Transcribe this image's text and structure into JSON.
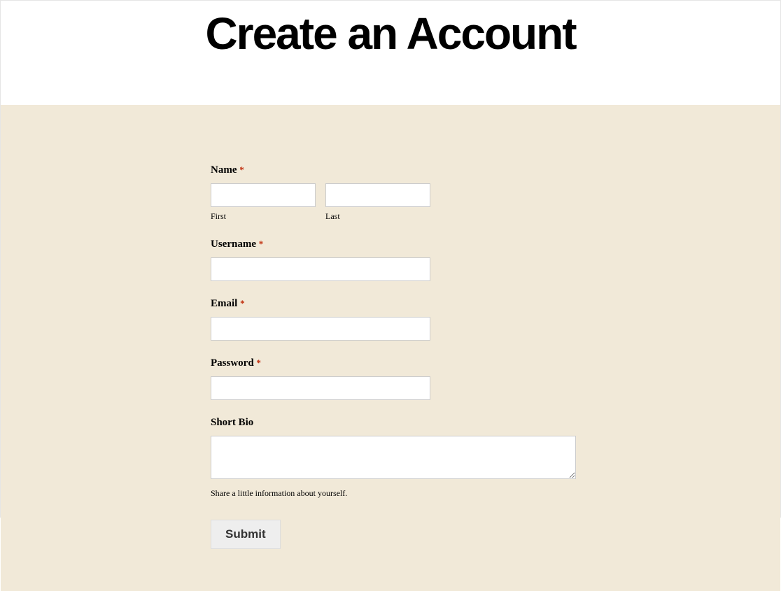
{
  "header": {
    "title": "Create an Account"
  },
  "form": {
    "name": {
      "label": "Name",
      "required_marker": "*",
      "first": {
        "sublabel": "First",
        "value": ""
      },
      "last": {
        "sublabel": "Last",
        "value": ""
      }
    },
    "username": {
      "label": "Username",
      "required_marker": "*",
      "value": ""
    },
    "email": {
      "label": "Email",
      "required_marker": "*",
      "value": ""
    },
    "password": {
      "label": "Password",
      "required_marker": "*",
      "value": ""
    },
    "bio": {
      "label": "Short Bio",
      "helper": "Share a little information about yourself.",
      "value": ""
    },
    "submit": {
      "label": "Submit"
    }
  }
}
